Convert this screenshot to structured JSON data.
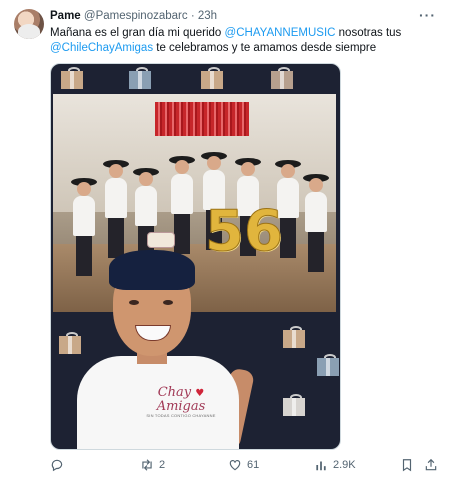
{
  "post": {
    "author": {
      "name": "Pame",
      "handle": "@Pamespinozabarc",
      "separator": "·",
      "time": "23h"
    },
    "more_icon": "ellipsis-icon",
    "text": {
      "t1": "Mañana es el gran día mi querido ",
      "mention1": "@CHAYANNEMUSIC",
      "t2": " nosotras tus",
      "mention2": "@ChileChayAmigas",
      "t3": " te celebramos y te amamos desde siempre"
    },
    "media": {
      "balloon_number": "56",
      "shirt_logo": "Chay Amigas",
      "shirt_logo_line1": "Chay",
      "shirt_logo_line2": "Amigas",
      "shirt_logo_sub": "SIN TODAS CONTIGO CHAYANNE"
    },
    "actions": {
      "reply": {
        "icon": "reply-icon",
        "count": ""
      },
      "repost": {
        "icon": "repost-icon",
        "count": "2"
      },
      "like": {
        "icon": "like-icon",
        "count": "61"
      },
      "views": {
        "icon": "views-icon",
        "count": "2.9K"
      },
      "bookmark": {
        "icon": "bookmark-icon",
        "count": ""
      },
      "share": {
        "icon": "share-icon",
        "count": ""
      }
    }
  }
}
